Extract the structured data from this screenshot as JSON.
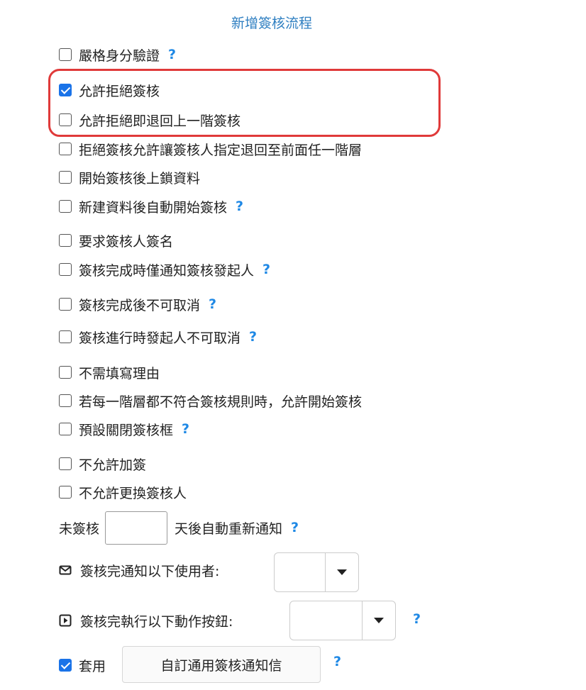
{
  "title": "新增簽核流程",
  "options": [
    {
      "label": "嚴格身分驗證",
      "checked": false,
      "help": "?"
    },
    {
      "label": "允許拒絕簽核",
      "checked": true
    },
    {
      "label": "允許拒絕即退回上一階簽核",
      "checked": false
    },
    {
      "label": "拒絕簽核允許讓簽核人指定退回至前面任一階層",
      "checked": false
    },
    {
      "label": "開始簽核後上鎖資料",
      "checked": false
    },
    {
      "label": "新建資料後自動開始簽核",
      "checked": false,
      "help": "?"
    },
    {
      "label": "要求簽核人簽名",
      "checked": false
    },
    {
      "label": "簽核完成時僅通知簽核發起人",
      "checked": false,
      "help": "?"
    },
    {
      "label": "簽核完成後不可取消",
      "checked": false,
      "help": "?"
    },
    {
      "label": "簽核進行時發起人不可取消",
      "checked": false,
      "help": "?"
    },
    {
      "label": "不需填寫理由",
      "checked": false
    },
    {
      "label": "若每一階層都不符合簽核規則時，允許開始簽核",
      "checked": false
    },
    {
      "label": "預設關閉簽核框",
      "checked": false,
      "help": "?"
    },
    {
      "label": "不允許加簽",
      "checked": false
    },
    {
      "label": "不允許更換簽核人",
      "checked": false
    }
  ],
  "reminder": {
    "prefix": "未簽核",
    "value": "",
    "suffix": "天後自動重新通知",
    "help": "?"
  },
  "notify_users": {
    "icon": "envelope-icon",
    "label": "簽核完通知以下使用者:",
    "selected": ""
  },
  "run_action": {
    "icon": "play-box-icon",
    "label": "簽核完執行以下動作按鈕:",
    "selected": "",
    "help": "?"
  },
  "apply": {
    "checked": true,
    "label": "套用",
    "button_label": "自訂通用簽核通知信",
    "help": "?"
  },
  "colors": {
    "accent": "#1a73e8",
    "help": "#1e88e5",
    "title": "#2f7fc1",
    "highlight_border": "#e03a3a"
  }
}
